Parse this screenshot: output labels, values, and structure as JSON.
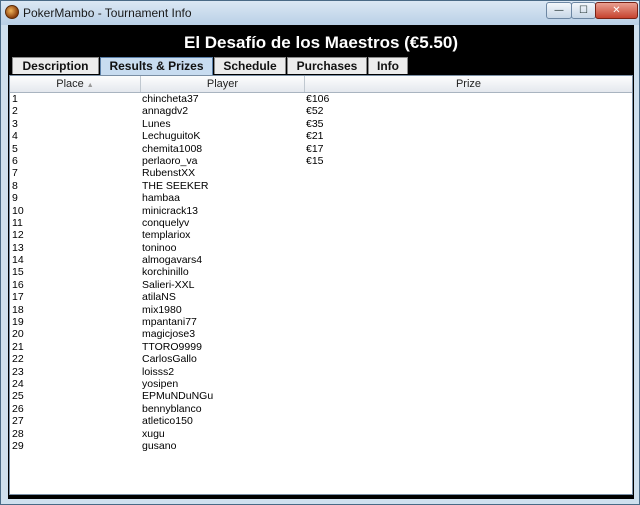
{
  "window": {
    "title": "PokerMambo - Tournament Info",
    "minimize_glyph": "—",
    "maximize_glyph": "☐",
    "close_glyph": "✕"
  },
  "heading": "El Desafío de los Maestros (€5.50)",
  "tabs": [
    {
      "label": "Description",
      "active": false
    },
    {
      "label": "Results & Prizes",
      "active": true
    },
    {
      "label": "Schedule",
      "active": false
    },
    {
      "label": "Purchases",
      "active": false
    },
    {
      "label": "Info",
      "active": false
    }
  ],
  "table": {
    "columns": [
      "Place",
      "Player",
      "Prize"
    ],
    "rows": [
      {
        "place": "1",
        "player": "chincheta37",
        "prize": "€106"
      },
      {
        "place": "2",
        "player": "annagdv2",
        "prize": "€52"
      },
      {
        "place": "3",
        "player": "Lunes",
        "prize": "€35"
      },
      {
        "place": "4",
        "player": "LechuguitoK",
        "prize": "€21"
      },
      {
        "place": "5",
        "player": "chemita1008",
        "prize": "€17"
      },
      {
        "place": "6",
        "player": "perlaoro_va",
        "prize": "€15"
      },
      {
        "place": "7",
        "player": "RubenstXX",
        "prize": ""
      },
      {
        "place": "8",
        "player": "THE SEEKER",
        "prize": ""
      },
      {
        "place": "9",
        "player": "hambaa",
        "prize": ""
      },
      {
        "place": "10",
        "player": "minicrack13",
        "prize": ""
      },
      {
        "place": "11",
        "player": "conquelyv",
        "prize": ""
      },
      {
        "place": "12",
        "player": "templariox",
        "prize": ""
      },
      {
        "place": "13",
        "player": "toninoo",
        "prize": ""
      },
      {
        "place": "14",
        "player": "almogavars4",
        "prize": ""
      },
      {
        "place": "15",
        "player": "korchinillo",
        "prize": ""
      },
      {
        "place": "16",
        "player": "Salieri-XXL",
        "prize": ""
      },
      {
        "place": "17",
        "player": "atilaNS",
        "prize": ""
      },
      {
        "place": "18",
        "player": "mix1980",
        "prize": ""
      },
      {
        "place": "19",
        "player": "mpantani77",
        "prize": ""
      },
      {
        "place": "20",
        "player": "magicjose3",
        "prize": ""
      },
      {
        "place": "21",
        "player": "TTORO9999",
        "prize": ""
      },
      {
        "place": "22",
        "player": "CarlosGallo",
        "prize": ""
      },
      {
        "place": "23",
        "player": "loisss2",
        "prize": ""
      },
      {
        "place": "24",
        "player": "yosipen",
        "prize": ""
      },
      {
        "place": "25",
        "player": "EPMuNDuNGu",
        "prize": ""
      },
      {
        "place": "26",
        "player": "bennyblanco",
        "prize": ""
      },
      {
        "place": "27",
        "player": "atletico150",
        "prize": ""
      },
      {
        "place": "28",
        "player": "xugu",
        "prize": ""
      },
      {
        "place": "29",
        "player": "gusano",
        "prize": ""
      }
    ]
  },
  "icons": {
    "app": "pokermambo-logo-icon",
    "sort": "sort-ascending-icon"
  },
  "colors": {
    "content_background": "#000000",
    "heading_text": "#ffffff",
    "active_tab": "#c8dcf0",
    "close_button": "#c6432f"
  }
}
